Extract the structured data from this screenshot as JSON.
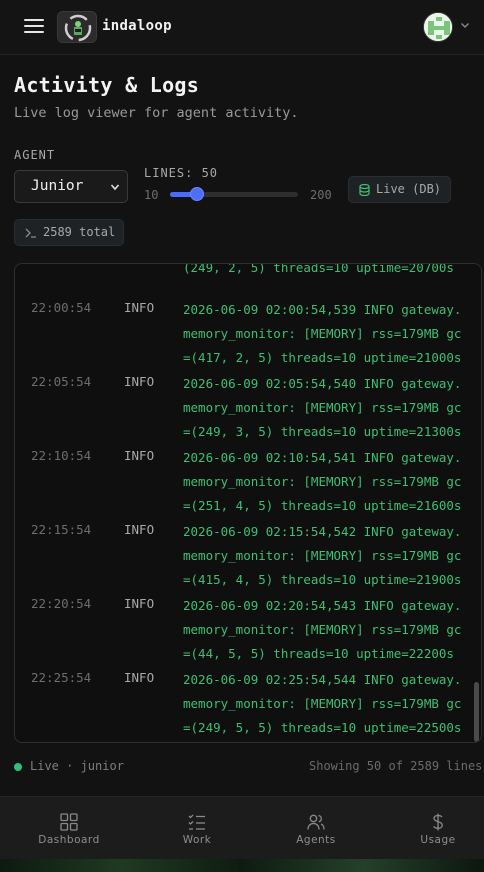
{
  "header": {
    "brand": "indaloop",
    "menu_icon": "hamburger-icon",
    "avatar_icon": "avatar-badge-icon",
    "chevron_icon": "chevron-down-icon"
  },
  "page": {
    "title": "Activity & Logs",
    "subtitle": "Live log viewer for agent activity."
  },
  "controls": {
    "agent_label": "AGENT",
    "agent_selected": "Junior",
    "lines_label": "LINES: 50",
    "lines_min": "10",
    "lines_max": "200",
    "lines_value": 50,
    "live_label": "Live (DB)",
    "total_label": "2589 total"
  },
  "logs": {
    "partial_top": "(249, 2, 5) threads=10 uptime=20700s",
    "rows": [
      {
        "time": "22:00:54",
        "level": "INFO",
        "message": "2026-06-09 02:00:54,539 INFO gateway.memory_monitor: [MEMORY] rss=179MB gc=(417, 2, 5) threads=10 uptime=21000s"
      },
      {
        "time": "22:05:54",
        "level": "INFO",
        "message": "2026-06-09 02:05:54,540 INFO gateway.memory_monitor: [MEMORY] rss=179MB gc=(249, 3, 5) threads=10 uptime=21300s"
      },
      {
        "time": "22:10:54",
        "level": "INFO",
        "message": "2026-06-09 02:10:54,541 INFO gateway.memory_monitor: [MEMORY] rss=179MB gc=(251, 4, 5) threads=10 uptime=21600s"
      },
      {
        "time": "22:15:54",
        "level": "INFO",
        "message": "2026-06-09 02:15:54,542 INFO gateway.memory_monitor: [MEMORY] rss=179MB gc=(415, 4, 5) threads=10 uptime=21900s"
      },
      {
        "time": "22:20:54",
        "level": "INFO",
        "message": "2026-06-09 02:20:54,543 INFO gateway.memory_monitor: [MEMORY] rss=179MB gc=(44, 5, 5) threads=10 uptime=22200s"
      },
      {
        "time": "22:25:54",
        "level": "INFO",
        "message": "2026-06-09 02:25:54,544 INFO gateway.memory_monitor: [MEMORY] rss=179MB gc=(249, 5, 5) threads=10 uptime=22500s"
      }
    ]
  },
  "status": {
    "live_text": "Live · junior",
    "showing_text": "Showing 50 of 2589 lines"
  },
  "nav": {
    "items": [
      {
        "label": "Dashboard",
        "icon": "grid-icon"
      },
      {
        "label": "Work",
        "icon": "checklist-icon"
      },
      {
        "label": "Agents",
        "icon": "users-icon"
      },
      {
        "label": "Usage",
        "icon": "dollar-icon"
      }
    ]
  },
  "colors": {
    "background": "#121212",
    "log_text": "#3fbf72",
    "accent": "#4f6ef7",
    "live_dot": "#2bc37a"
  }
}
